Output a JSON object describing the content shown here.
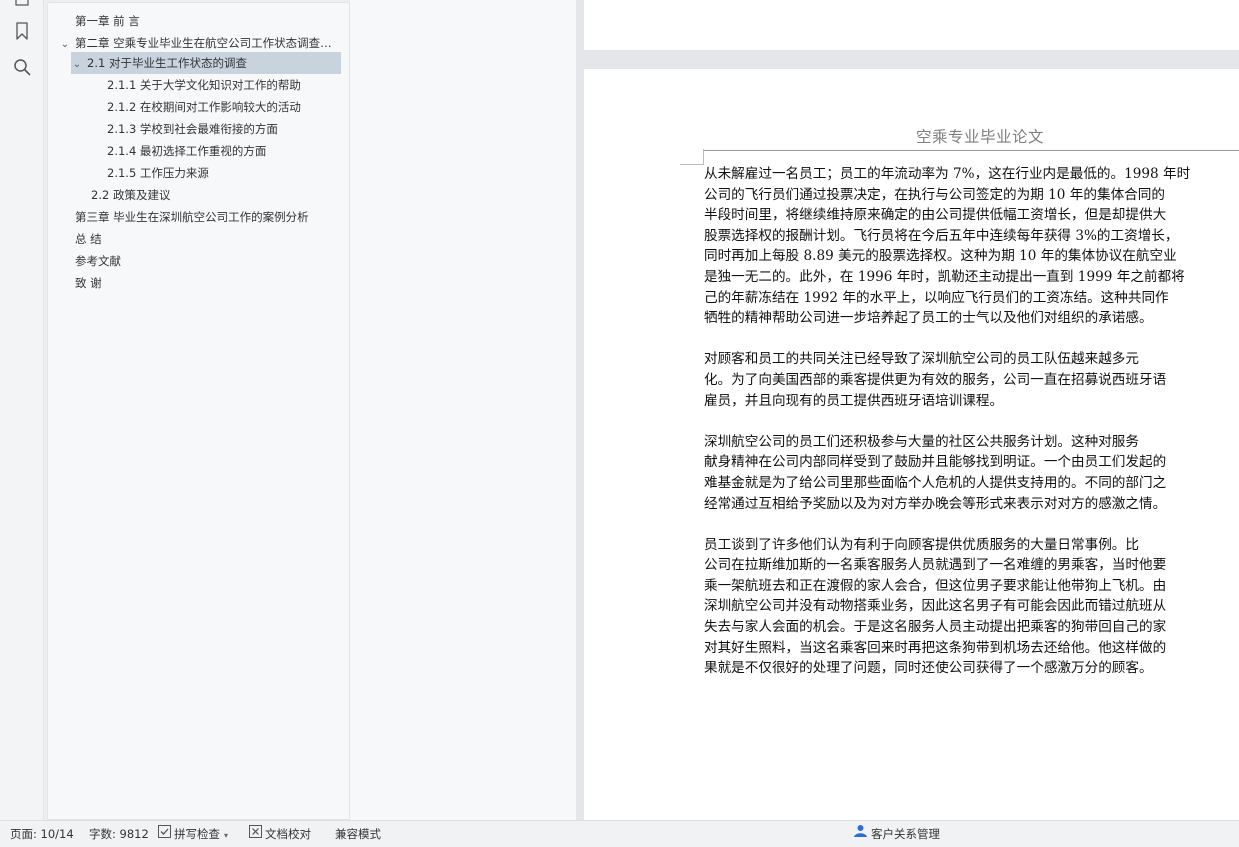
{
  "outline": {
    "items": [
      {
        "label": "第一章  前    言"
      },
      {
        "label": "第二章  空乘专业毕业生在航空公司工作状态调查与分析"
      },
      {
        "label": "2.1  对于毕业生工作状态的调查"
      },
      {
        "label": "2.1.1 关于大学文化知识对工作的帮助"
      },
      {
        "label": "2.1.2  在校期间对工作影响较大的活动"
      },
      {
        "label": "2.1.3 学校到社会最难衔接的方面"
      },
      {
        "label": "2.1.4 最初选择工作重视的方面"
      },
      {
        "label": "2.1.5 工作压力来源"
      },
      {
        "label": "2.2  政策及建议"
      },
      {
        "label": "第三章  毕业生在深圳航空公司工作的案例分析"
      },
      {
        "label": "总    结"
      },
      {
        "label": "参考文献"
      },
      {
        "label": "致    谢"
      }
    ]
  },
  "document": {
    "header": "空乘专业毕业论文",
    "lines": [
      "从未解雇过一名员工；员工的年流动率为 7%，这在行业内是最低的。1998 年时",
      "公司的飞行员们通过投票决定，在执行与公司签定的为期 10 年的集体合同的",
      "半段时间里，将继续维持原来确定的由公司提供低幅工资增长，但是却提供大",
      "股票选择权的报酬计划。飞行员将在今后五年中连续每年获得 3%的工资增长，",
      "同时再加上每股 8.89 美元的股票选择权。这种为期 10 年的集体协议在航空业",
      "是独一无二的。此外，在 1996 年时，凯勒还主动提出一直到 1999 年之前都将",
      "己的年薪冻结在 1992 年的水平上，以响应飞行员们的工资冻结。这种共同作",
      "牺牲的精神帮助公司进一步培养起了员工的士气以及他们对组织的承诺感。",
      "",
      "        对顾客和员工的共同关注已经导致了深圳航空公司的员工队伍越来越多元",
      "化。为了向美国西部的乘客提供更为有效的服务，公司一直在招募说西班牙语",
      "雇员，并且向现有的员工提供西班牙语培训课程。",
      "",
      "        深圳航空公司的员工们还积极参与大量的社区公共服务计划。这种对服务",
      "献身精神在公司内部同样受到了鼓励并且能够找到明证。一个由员工们发起的",
      "难基金就是为了给公司里那些面临个人危机的人提供支持用的。不同的部门之",
      "经常通过互相给予奖励以及为对方举办晚会等形式来表示对对方的感激之情。",
      "",
      "        员工谈到了许多他们认为有利于向顾客提供优质服务的大量日常事例。比",
      "公司在拉斯维加斯的一名乘客服务人员就遇到了一名难缠的男乘客，当时他要",
      "乘一架航班去和正在渡假的家人会合，但这位男子要求能让他带狗上飞机。由",
      "深圳航空公司并没有动物搭乘业务，因此这名男子有可能会因此而错过航班从",
      "失去与家人会面的机会。于是这名服务人员主动提出把乘客的狗带回自己的家",
      "对其好生照料，当这名乘客回来时再把这条狗带到机场去还给他。他这样做的",
      "果就是不仅很好的处理了问题，同时还使公司获得了一个感激万分的顾客。"
    ]
  },
  "status": {
    "page": "页面: 10/14",
    "words": "字数: 9812",
    "spell": "拼写检查",
    "proof": "文档校对",
    "compat": "兼容模式",
    "crm": "客户关系管理"
  },
  "icons": [
    "list-icon",
    "bookmark-icon",
    "search-icon",
    "check-icon",
    "proof-icon",
    "crm-icon"
  ],
  "colors": {
    "accent": "#2b6fd6",
    "selection": "#c9d3de"
  }
}
